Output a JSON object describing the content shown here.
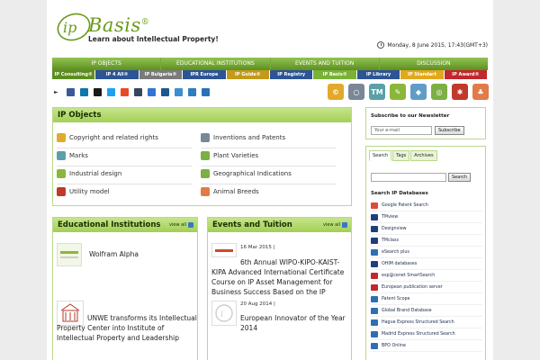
{
  "brand": {
    "logo_mark": "ip",
    "name": "Basis",
    "reg": "®",
    "tagline": "Learn about Intellectual Property!"
  },
  "datetime": "Monday, 8 June 2015, 17:43(GMT+3)",
  "main_nav": [
    "IP OBJECTS",
    "EDUCATIONAL INSTITUTIONS",
    "EVENTS AND TUITION",
    "DISCUSSION"
  ],
  "sub_nav": [
    {
      "label": "IP Consulting®",
      "color": "#5d8d1f"
    },
    {
      "label": "IP 4 All®",
      "color": "#2d5494"
    },
    {
      "label": "IP Bulgaria®",
      "color": "#7a7a7a"
    },
    {
      "label": "IPR Europe",
      "color": "#2d5494"
    },
    {
      "label": "IP Guide®",
      "color": "#c39a1a"
    },
    {
      "label": "IP Registry",
      "color": "#2d5494"
    },
    {
      "label": "IP Basis®",
      "color": "#7ab236"
    },
    {
      "label": "IP Library",
      "color": "#2d5494"
    },
    {
      "label": "IP Standart",
      "color": "#e0a81c"
    },
    {
      "label": "IP Award®",
      "color": "#c1272d"
    }
  ],
  "social_icons": [
    {
      "name": "facebook-icon",
      "color": "#3b5998"
    },
    {
      "name": "linkedin-icon",
      "color": "#0e76a8"
    },
    {
      "name": "myspace-icon",
      "color": "#1a1a1a"
    },
    {
      "name": "twitter-icon",
      "color": "#1da1f2"
    },
    {
      "name": "stumbleupon-icon",
      "color": "#eb4924"
    },
    {
      "name": "tumblr-icon",
      "color": "#35465c"
    },
    {
      "name": "delicious-icon",
      "color": "#3274d1"
    },
    {
      "name": "digg-icon",
      "color": "#1b5891"
    },
    {
      "name": "email-icon",
      "color": "#3a8fd0"
    },
    {
      "name": "print-icon",
      "color": "#2a7ec1"
    },
    {
      "name": "share-icon",
      "color": "#2a70b8"
    }
  ],
  "big_icons": [
    {
      "name": "copyright-icon",
      "glyph": "©",
      "color": "#e2a92a"
    },
    {
      "name": "search-icon",
      "glyph": "○",
      "color": "#7a8796"
    },
    {
      "name": "trademark-icon",
      "glyph": "TM",
      "color": "#5aa0a8"
    },
    {
      "name": "pencil-icon",
      "glyph": "✎",
      "color": "#8ab73a"
    },
    {
      "name": "cube-icon",
      "glyph": "◆",
      "color": "#5f9dc8"
    },
    {
      "name": "globe-icon",
      "glyph": "◎",
      "color": "#7cb043"
    },
    {
      "name": "gear-icon",
      "glyph": "✱",
      "color": "#c0392b"
    },
    {
      "name": "tree-icon",
      "glyph": "♣",
      "color": "#e37a4a"
    }
  ],
  "ip_objects": {
    "title": "IP Objects",
    "left": [
      {
        "label": "Copyright and related rights",
        "icon": "copyright-icon",
        "color": "#e2a92a"
      },
      {
        "label": "Marks",
        "icon": "trademark-icon",
        "color": "#5aa0a8"
      },
      {
        "label": "Industrial design",
        "icon": "pencil-icon",
        "color": "#8ab73a"
      },
      {
        "label": "Utility model",
        "icon": "gear-icon",
        "color": "#c0392b"
      }
    ],
    "right": [
      {
        "label": "Inventions and Patents",
        "icon": "search-icon",
        "color": "#7a8796"
      },
      {
        "label": "Plant Varieties",
        "icon": "leaf-icon",
        "color": "#7cb043"
      },
      {
        "label": "Geographical Indications",
        "icon": "globe-icon",
        "color": "#7cb043"
      },
      {
        "label": "Animal Breeds",
        "icon": "animal-icon",
        "color": "#e37a4a"
      }
    ]
  },
  "edu": {
    "title": "Educational Institutions",
    "view_all": "view all",
    "items": [
      {
        "text": "Wolfram Alpha"
      },
      {
        "text": "UNWE transforms its Intellectual Property Center into Institute of Intellectual Property and Leadership"
      }
    ]
  },
  "events": {
    "title": "Events and Tuition",
    "view_all": "view all",
    "items": [
      {
        "date": "16 Mar 2015",
        "text": "6th Annual WIPO-KIPO-KAIST-KIPA Advanced International Certificate Course on IP Asset Management for Business Success Based on the IP"
      },
      {
        "date": "20 Aug 2014",
        "text": "European Innovator of the Year 2014"
      }
    ]
  },
  "newsletter": {
    "title": "Subscribe to our Newsletter",
    "placeholder": "Your e-mail",
    "button": "Subscribe"
  },
  "sidebar": {
    "tabs": [
      "Search",
      "Tags",
      "Archives"
    ],
    "search_button": "Search",
    "db_title": "Search IP Databases",
    "databases": [
      {
        "label": "Google Patent Search",
        "color": "#dd4b39"
      },
      {
        "label": "TMview",
        "color": "#1f3f7a"
      },
      {
        "label": "Designview",
        "color": "#1f3f7a"
      },
      {
        "label": "TMclass",
        "color": "#1f3f7a"
      },
      {
        "label": "eSearch plus",
        "color": "#2c6fb2"
      },
      {
        "label": "OHIM databases",
        "color": "#1f3f7a"
      },
      {
        "label": "esp@cenet SmartSearch",
        "color": "#c1272d"
      },
      {
        "label": "European publication server",
        "color": "#c1272d"
      },
      {
        "label": "Patent Scope",
        "color": "#2c6fb2"
      },
      {
        "label": "Global Brand Database",
        "color": "#2c6fb2"
      },
      {
        "label": "Hague Express Structured Search",
        "color": "#2c6fb2"
      },
      {
        "label": "Madrid Express Structured Search",
        "color": "#2c6fb2"
      },
      {
        "label": "BPO Online",
        "color": "#2c6fb2"
      }
    ]
  }
}
